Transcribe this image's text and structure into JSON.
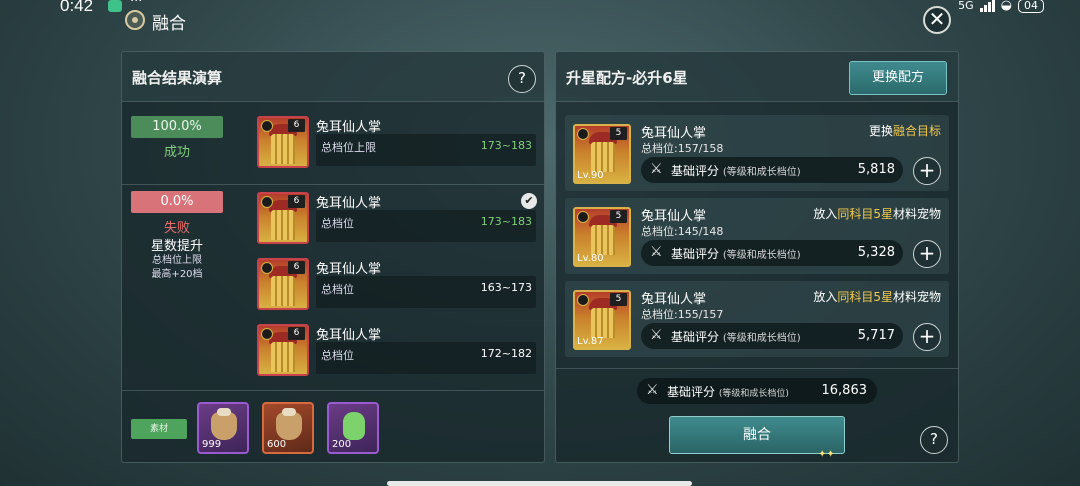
{
  "status_bar": {
    "time": "0:42",
    "dots": "···",
    "network": "5G",
    "battery": "04"
  },
  "header": {
    "title": "融合"
  },
  "left_panel": {
    "title": "融合结果演算",
    "success": {
      "percent": "100.0%",
      "label": "成功"
    },
    "fail": {
      "percent": "0.0%",
      "label": "失败",
      "upgrade": "星数提升",
      "note_line1": "总档位上限",
      "note_line2": "最高+20档"
    },
    "results": [
      {
        "name": "兔耳仙人掌",
        "stars": "6",
        "label": "总档位上限",
        "range": "173~183",
        "range_color": "green"
      },
      {
        "name": "兔耳仙人掌",
        "stars": "6",
        "label": "总档位",
        "range": "173~183",
        "range_color": "green",
        "checked": true
      },
      {
        "name": "兔耳仙人掌",
        "stars": "6",
        "label": "总档位",
        "range": "163~173",
        "range_color": "white"
      },
      {
        "name": "兔耳仙人掌",
        "stars": "6",
        "label": "总档位",
        "range": "172~182",
        "range_color": "white"
      }
    ],
    "cost_tag": "素材",
    "costs": [
      {
        "qty": "999",
        "frame": "purple",
        "icon": "bag-icon"
      },
      {
        "qty": "600",
        "frame": "orange",
        "icon": "bag-icon"
      },
      {
        "qty": "200",
        "frame": "purple",
        "icon": "potion-icon"
      }
    ]
  },
  "right_panel": {
    "title": "升星配方-必升6星",
    "swap_button": "更换配方",
    "materials": [
      {
        "name": "兔耳仙人掌",
        "stars": "5",
        "level": "Lv.90",
        "level_text": "总档位:157/158",
        "action_pre": "更换",
        "action_hl": "融合目标",
        "action_post": "",
        "score_label": "基础评分",
        "score_note": "(等级和成长档位)",
        "score": "5,818"
      },
      {
        "name": "兔耳仙人掌",
        "stars": "5",
        "level": "Lv.80",
        "level_text": "总档位:145/148",
        "action_pre": "放入",
        "action_hl": "同科目5星",
        "action_post": "材料宠物",
        "score_label": "基础评分",
        "score_note": "(等级和成长档位)",
        "score": "5,328"
      },
      {
        "name": "兔耳仙人掌",
        "stars": "5",
        "level": "Lv.87",
        "level_text": "总档位:155/157",
        "action_pre": "放入",
        "action_hl": "同科目5星",
        "action_post": "材料宠物",
        "score_label": "基础评分",
        "score_note": "(等级和成长档位)",
        "score": "5,717"
      }
    ],
    "total": {
      "label": "基础评分",
      "note": "(等级和成长档位)",
      "value": "16,863"
    },
    "fuse_button": "融合"
  },
  "colors": {
    "success_green": "#4b8c5a",
    "fail_red": "#d9737a",
    "highlight_yellow": "#f2c94c",
    "button_teal": "#3f8b8e"
  }
}
